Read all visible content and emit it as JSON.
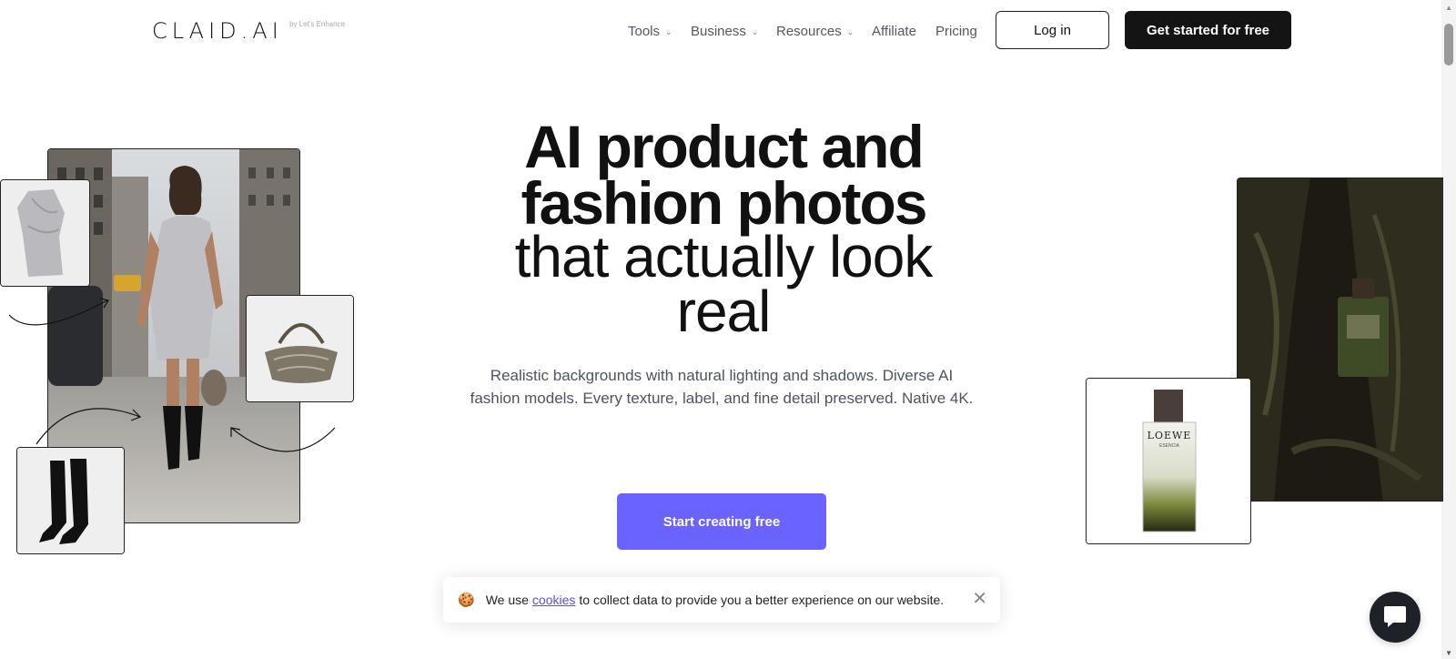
{
  "brand": {
    "logo": "CLAID.AI",
    "sub": "by Let's Enhance"
  },
  "nav": {
    "items": [
      {
        "label": "Tools",
        "has_dropdown": true
      },
      {
        "label": "Business",
        "has_dropdown": true
      },
      {
        "label": "Resources",
        "has_dropdown": true
      },
      {
        "label": "Affiliate",
        "has_dropdown": false
      },
      {
        "label": "Pricing",
        "has_dropdown": false
      }
    ],
    "chevron": "⌄",
    "login_label": "Log in",
    "cta_label": "Get started for free"
  },
  "hero": {
    "title_bold_line1": "AI product and",
    "title_bold_line2": "fashion photos",
    "title_light_line1": "that actually look",
    "title_light_line2": "real",
    "description": "Realistic backgrounds with natural lighting and shadows. Diverse AI fashion models. Every texture, label, and fine detail preserved. Native 4K.",
    "cta_label": "Start creating free"
  },
  "perfume": {
    "brand": "LOEWE",
    "sub": "ESENCIA"
  },
  "cookie_banner": {
    "emoji": "🍪",
    "text_before": "We use",
    "link_text": "cookies",
    "text_after": "to collect data to provide you a better experience on our website.",
    "close_glyph": "✕"
  },
  "colors": {
    "accent": "#6b63ff",
    "dark": "#141414",
    "text_muted": "#4d5360"
  },
  "icons": [
    "chevron-down-icon",
    "close-icon",
    "chat-icon",
    "cookie-icon"
  ]
}
